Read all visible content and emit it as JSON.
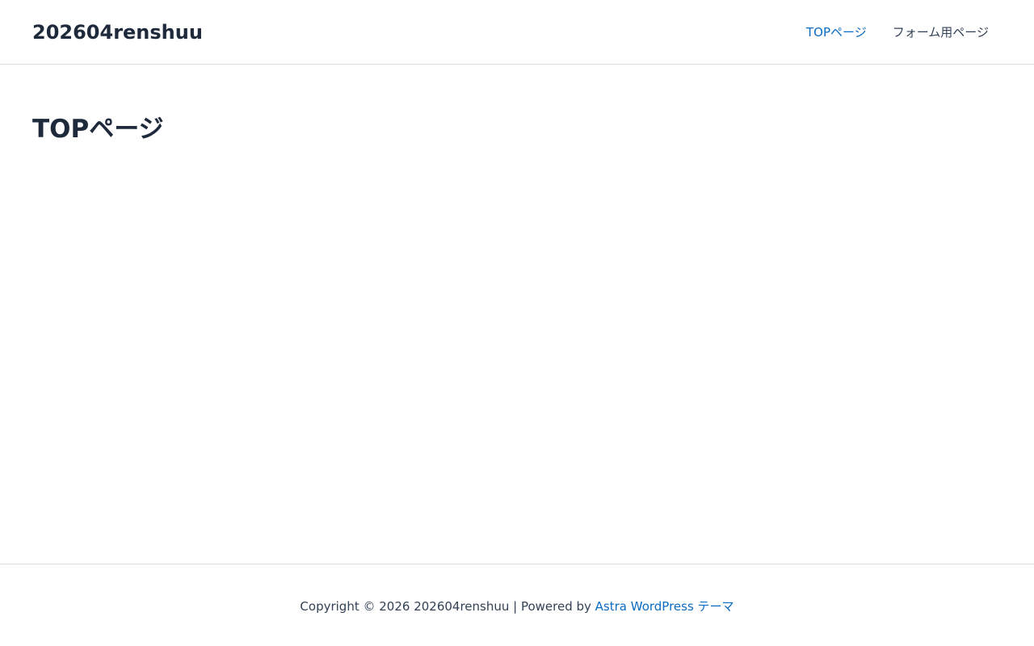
{
  "header": {
    "site_title": "202604renshuu",
    "nav": [
      {
        "label": "TOPページ",
        "current": true
      },
      {
        "label": "フォーム用ページ",
        "current": false
      }
    ]
  },
  "main": {
    "page_title": "TOPページ"
  },
  "footer": {
    "copyright_prefix": "Copyright © 2026 202604renshuu | Powered by",
    "theme_link": "Astra WordPress テーマ"
  },
  "colors": {
    "text": "#1e293b",
    "link": "#0a6cc2",
    "border": "#dddddd",
    "background": "#ffffff"
  }
}
